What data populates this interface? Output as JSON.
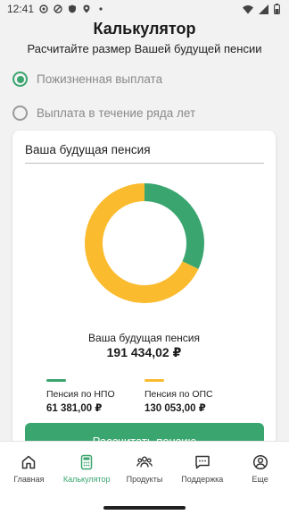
{
  "status_bar": {
    "time": "12:41"
  },
  "header": {
    "title": "Калькулятор",
    "subtitle": "Расчитайте размер Вашей будущей пенсии"
  },
  "options": [
    {
      "label": "Пожизненная выплата",
      "selected": true
    },
    {
      "label": "Выплата в течение ряда лет",
      "selected": false
    }
  ],
  "card": {
    "title": "Ваша будущая пенсия",
    "total_label": "Ваша будущая пенсия",
    "total_value": "191 434,02 ₽",
    "legend": [
      {
        "label": "Пенсия по НПО",
        "value": "61 381,00 ₽",
        "color": "#3aa56f"
      },
      {
        "label": "Пенсия по ОПС",
        "value": "130 053,00 ₽",
        "color": "#fbbb2e"
      }
    ],
    "button_label": "Рассчитать пенсию"
  },
  "chart_data": {
    "type": "pie",
    "categories": [
      "Пенсия по НПО",
      "Пенсия по ОПС"
    ],
    "values": [
      61381.0,
      130053.0
    ],
    "colors": [
      "#3aa56f",
      "#fbbb2e"
    ]
  },
  "bottom_nav": [
    {
      "label": "Главная",
      "icon": "home-icon",
      "active": false
    },
    {
      "label": "Калькулятор",
      "icon": "calculator-icon",
      "active": true
    },
    {
      "label": "Продукты",
      "icon": "people-icon",
      "active": false
    },
    {
      "label": "Поддержка",
      "icon": "chat-icon",
      "active": false
    },
    {
      "label": "Еще",
      "icon": "profile-icon",
      "active": false
    }
  ],
  "colors": {
    "accent": "#3aa56f",
    "secondary": "#fbbb2e"
  }
}
